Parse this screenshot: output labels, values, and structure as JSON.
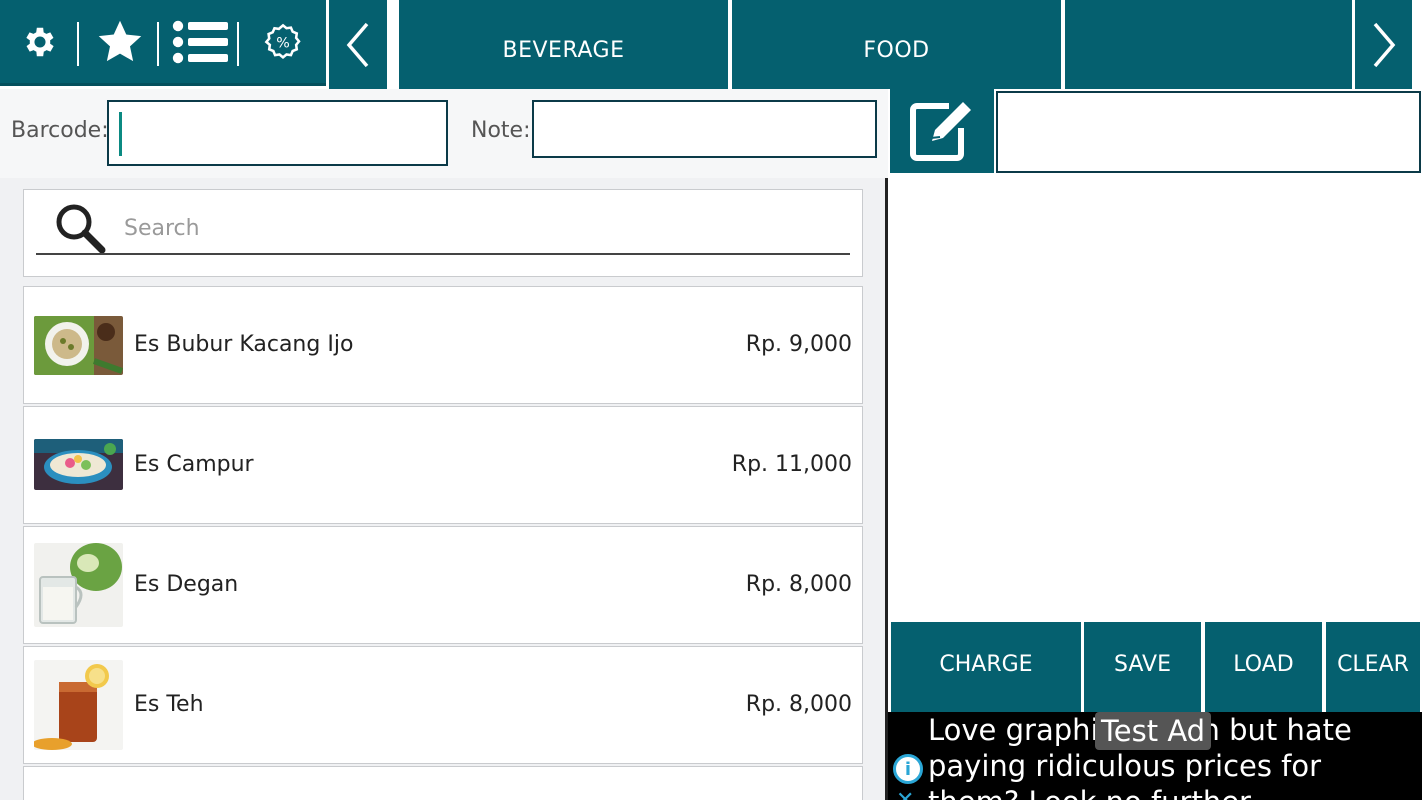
{
  "toolbar": {
    "icons": [
      "gear-icon",
      "star-icon",
      "list-icon",
      "discount-icon",
      "chevron-left-icon",
      "chevron-right-icon"
    ]
  },
  "categories": [
    {
      "label": "BEVERAGE"
    },
    {
      "label": "FOOD"
    },
    {
      "label": ""
    }
  ],
  "form": {
    "barcode_label": "Barcode:",
    "barcode_value": "",
    "note_label": "Note:",
    "note_value": ""
  },
  "search": {
    "placeholder": "Search"
  },
  "products": [
    {
      "name": "Es Bubur Kacang Ijo",
      "price": "Rp. 9,000",
      "thumb": "bubur-kacang-ijo-photo"
    },
    {
      "name": "Es Campur",
      "price": "Rp. 11,000",
      "thumb": "es-campur-photo"
    },
    {
      "name": "Es Degan",
      "price": "Rp. 8,000",
      "thumb": "es-degan-photo"
    },
    {
      "name": "Es Teh",
      "price": "Rp. 8,000",
      "thumb": "es-teh-photo"
    }
  ],
  "actions": {
    "charge": "CHARGE",
    "save": "SAVE",
    "load": "LOAD",
    "clear": "CLEAR"
  },
  "ad": {
    "label": "Test Ad",
    "text": "Love graphic design but hate paying ridiculous prices for them? Look no further"
  },
  "colors": {
    "primary": "#05606f",
    "background": "#f0f1f3",
    "border": "#0b3a48"
  }
}
